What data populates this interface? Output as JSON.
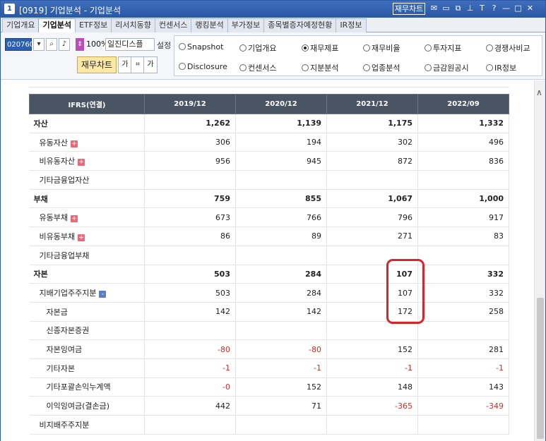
{
  "window": {
    "number": "1",
    "title": "[0919] 기업분석 - 기업분석",
    "chart_button": "재무차트",
    "title_icons": [
      "mail-icon",
      "window-icon",
      "copy-icon",
      "pin-icon",
      "font-icon",
      "help-icon",
      "minimize-icon",
      "maximize-icon",
      "close-icon"
    ],
    "title_icon_glyphs": [
      "✉",
      "▭",
      "⧉",
      "⊥",
      "T",
      "?",
      "—",
      "□",
      "✕"
    ]
  },
  "tabs": [
    "기업개요",
    "기업분석",
    "ETF정보",
    "리서치동향",
    "컨센서스",
    "랭킹분석",
    "부가정보",
    "종목별증자예정현황",
    "IR정보"
  ],
  "active_tab_index": 1,
  "toolbar": {
    "code": "020760",
    "zoom": "100%",
    "mode": "일진디스플",
    "settings_label": "설정",
    "fin_chart_button": "재무차트",
    "font_down": "가",
    "font_up": "가"
  },
  "radios": {
    "row1": [
      {
        "label": "Snapshot",
        "selected": false
      },
      {
        "label": "기업개요",
        "selected": false
      },
      {
        "label": "재무제표",
        "selected": true
      },
      {
        "label": "재무비율",
        "selected": false
      },
      {
        "label": "투자지표",
        "selected": false
      },
      {
        "label": "경쟁사비교",
        "selected": false
      }
    ],
    "row2": [
      {
        "label": "Disclosure",
        "selected": false
      },
      {
        "label": "컨센서스",
        "selected": false
      },
      {
        "label": "지분분석",
        "selected": false
      },
      {
        "label": "업종분석",
        "selected": false
      },
      {
        "label": "금감원공시",
        "selected": false
      },
      {
        "label": "IR정보",
        "selected": false
      }
    ]
  },
  "table": {
    "headers": [
      "IFRS(연결)",
      "2019/12",
      "2020/12",
      "2021/12",
      "2022/09"
    ],
    "rows": [
      {
        "label": "자산",
        "level": 0,
        "major": true,
        "toggle": "",
        "values": [
          "1,262",
          "1,139",
          "1,175",
          "1,332"
        ]
      },
      {
        "label": "유동자산",
        "level": 1,
        "major": false,
        "toggle": "+",
        "values": [
          "306",
          "194",
          "302",
          "496"
        ]
      },
      {
        "label": "비유동자산",
        "level": 1,
        "major": false,
        "toggle": "+",
        "values": [
          "956",
          "945",
          "872",
          "836"
        ]
      },
      {
        "label": "기타금융업자산",
        "level": 1,
        "major": false,
        "toggle": "",
        "values": [
          "",
          "",
          "",
          ""
        ]
      },
      {
        "label": "부채",
        "level": 0,
        "major": true,
        "toggle": "",
        "values": [
          "759",
          "855",
          "1,067",
          "1,000"
        ]
      },
      {
        "label": "유동부채",
        "level": 1,
        "major": false,
        "toggle": "+",
        "values": [
          "673",
          "766",
          "796",
          "917"
        ]
      },
      {
        "label": "비유동부채",
        "level": 1,
        "major": false,
        "toggle": "+",
        "values": [
          "86",
          "89",
          "271",
          "83"
        ]
      },
      {
        "label": "기타금융업부채",
        "level": 1,
        "major": false,
        "toggle": "",
        "values": [
          "",
          "",
          "",
          ""
        ]
      },
      {
        "label": "자본",
        "level": 0,
        "major": true,
        "toggle": "",
        "values": [
          "503",
          "284",
          "107",
          "332"
        ]
      },
      {
        "label": "지배기업주주지분",
        "level": 1,
        "major": false,
        "toggle": "-",
        "values": [
          "503",
          "284",
          "107",
          "332"
        ]
      },
      {
        "label": "자본금",
        "level": 2,
        "major": false,
        "toggle": "",
        "values": [
          "142",
          "142",
          "172",
          "258"
        ]
      },
      {
        "label": "신종자본증권",
        "level": 2,
        "major": false,
        "toggle": "",
        "values": [
          "",
          "",
          "",
          ""
        ]
      },
      {
        "label": "자본잉여금",
        "level": 2,
        "major": false,
        "toggle": "",
        "values": [
          "-80",
          "-80",
          "152",
          "281"
        ]
      },
      {
        "label": "기타자본",
        "level": 2,
        "major": false,
        "toggle": "",
        "values": [
          "-1",
          "-1",
          "-1",
          "-1"
        ]
      },
      {
        "label": "기타포괄손익누계액",
        "level": 2,
        "major": false,
        "toggle": "",
        "values": [
          "-0",
          "152",
          "148",
          "143"
        ]
      },
      {
        "label": "이익잉여금(결손금)",
        "level": 2,
        "major": false,
        "toggle": "",
        "values": [
          "442",
          "71",
          "-365",
          "-349"
        ]
      },
      {
        "label": "비지배주주지분",
        "level": 1,
        "major": false,
        "toggle": "",
        "values": [
          "",
          "",
          "",
          ""
        ]
      }
    ]
  },
  "colors": {
    "header_bg": "#4a5563",
    "negative": "#d52b2b",
    "highlight": "#d6262b",
    "title_bar": "#2b57a3"
  }
}
